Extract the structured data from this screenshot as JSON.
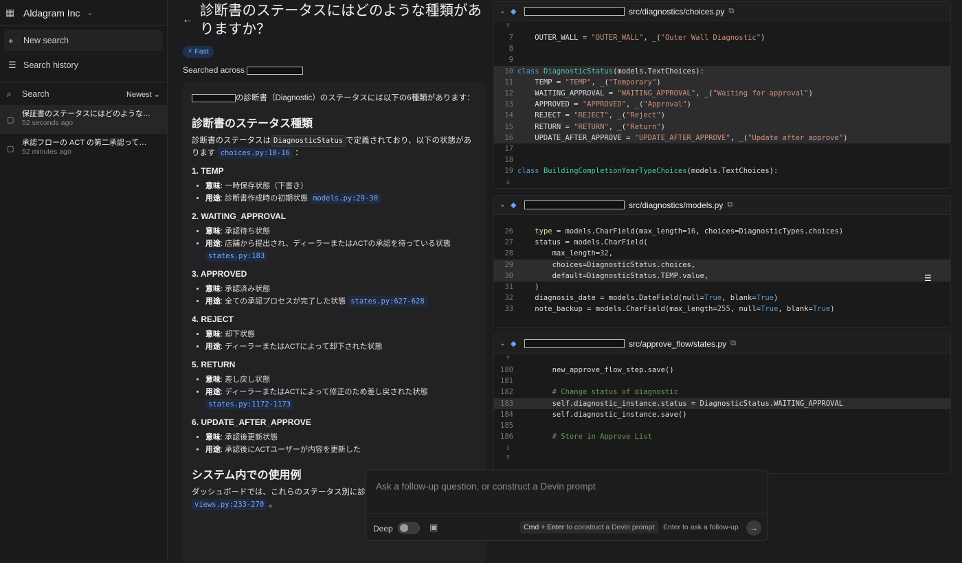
{
  "sidebar": {
    "org_name": "Aldagram Inc",
    "new_search": "New search",
    "search_history": "Search history",
    "search_label": "Search",
    "sort_label": "Newest",
    "history": [
      {
        "title": "保証書のステータスにはどのような…",
        "time": "52 seconds ago"
      },
      {
        "title": "承認フローの ACT の第二承認って…",
        "time": "52 minutes ago"
      }
    ]
  },
  "main": {
    "title": "診断書のステータスにはどのような種類がありますか？",
    "badge": "⚡ Fast",
    "searched_across": "Searched across",
    "intro": "の診断書（Diagnostic）のステータスには以下の6種類があります：",
    "h_types": "診断書のステータス種類",
    "defined_a": "診断書のステータスは",
    "defined_code": "DiagnosticStatus",
    "defined_b": "で定義されており、以下の状態があります",
    "defined_ref": "choices.py:10-16",
    "defined_c": "：",
    "meaning_label": "意味",
    "usage_label": "用途",
    "statuses": [
      {
        "heading": "1. TEMP",
        "meaning": "一時保存状態（下書き）",
        "usage": "診断書作成時の初期状態",
        "ref": "models.py:29-30"
      },
      {
        "heading": "2. WAITING_APPROVAL",
        "meaning": "承認待ち状態",
        "usage": "店舗から提出され、ディーラーまたはACTの承認を待っている状態",
        "ref": "states.py:183"
      },
      {
        "heading": "3. APPROVED",
        "meaning": "承認済み状態",
        "usage": "全ての承認プロセスが完了した状態",
        "ref": "states.py:627-628"
      },
      {
        "heading": "4. REJECT",
        "meaning": "却下状態",
        "usage": "ディーラーまたはACTによって却下された状態",
        "ref": ""
      },
      {
        "heading": "5. RETURN",
        "meaning": "差し戻し状態",
        "usage": "ディーラーまたはACTによって修正のため差し戻された状態",
        "ref": "states.py:1172-1173"
      },
      {
        "heading": "6. UPDATE_AFTER_APPROVE",
        "meaning": "承認後更新状態",
        "usage": "承認後にACTユーザーが内容を更新した",
        "ref": ""
      }
    ],
    "h_usage": "システム内での使用例",
    "usage_text": "ダッシュボードでは、これらのステータス別に診",
    "usage_ref": "views.py:233-270",
    "usage_end": "。"
  },
  "panels": [
    {
      "path": "src/diagnostics/choices.py"
    },
    {
      "path": "src/diagnostics/models.py"
    },
    {
      "path": "src/approve_flow/states.py"
    }
  ],
  "follow": {
    "placeholder": "Ask a follow-up question, or construct a Devin prompt",
    "deep_label": "Deep",
    "hint_keys": "Cmd + Enter",
    "hint_text": " to construct a Devin prompt",
    "hint2": "Enter to ask a follow-up"
  },
  "icons": {
    "org": "building-icon",
    "new": "plus-icon",
    "history": "list-icon",
    "search": "search-icon",
    "doc": "document-icon",
    "send": "arrow-right-icon"
  }
}
